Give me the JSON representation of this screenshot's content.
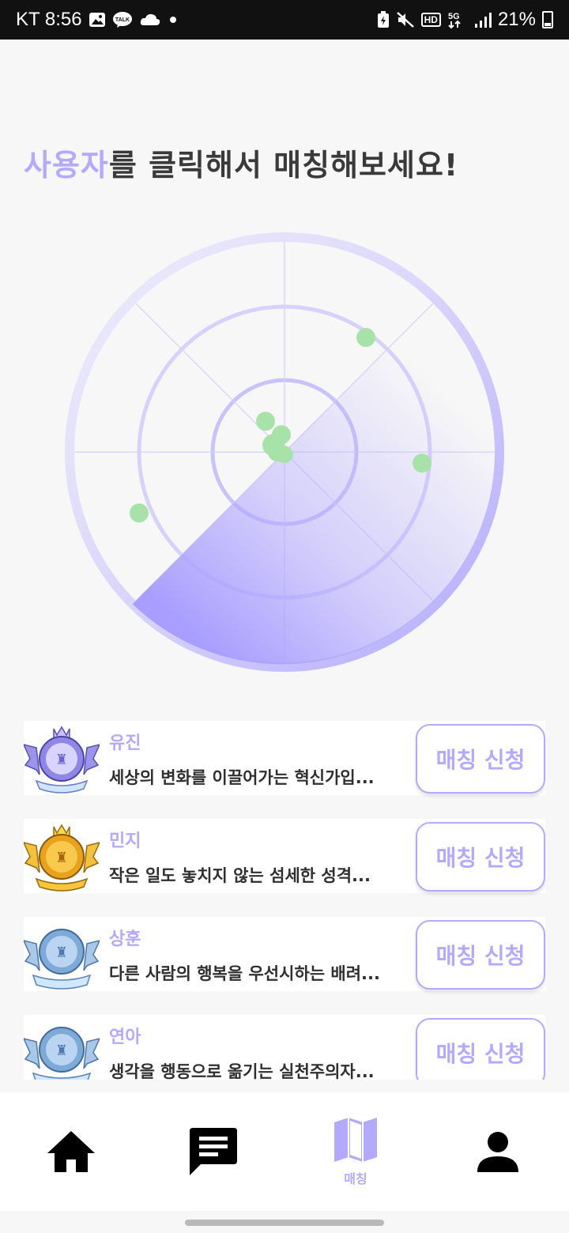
{
  "status_bar": {
    "carrier_time": "KT 8:56",
    "battery_percent": "21%",
    "icons": [
      "image-icon",
      "kakaotalk-icon",
      "cloud-icon",
      "dot-icon",
      "battery-saver-icon",
      "mute-icon",
      "hd-icon",
      "5g-icon",
      "signal-icon",
      "battery-icon"
    ],
    "hd_label": "HD",
    "net_label": "5G"
  },
  "headline": {
    "accent": "사용자",
    "rest": "를 클릭해서 매칭해보세요!"
  },
  "radar": {
    "accent_color": "#b3a9ff",
    "dot_color": "#a7e3a9",
    "users_visible": 8
  },
  "users": [
    {
      "name": "유진",
      "desc": "세상의 변화를 이끌어가는 혁신가입...",
      "button": "매칭 신청",
      "badge": "purple-wing-badge-icon"
    },
    {
      "name": "민지",
      "desc": "작은 일도 놓치지 않는 섬세한 성격...",
      "button": "매칭 신청",
      "badge": "gold-wing-badge-icon"
    },
    {
      "name": "상훈",
      "desc": "다른 사람의 행복을 우선시하는 배려...",
      "button": "매칭 신청",
      "badge": "blue-wing-badge-icon"
    },
    {
      "name": "연아",
      "desc": "생각을 행동으로 옮기는 실천주의자...",
      "button": "매칭 신청",
      "badge": "blue-wing-badge-icon"
    }
  ],
  "nav": {
    "home_icon": "home-icon",
    "chat_icon": "chat-icon",
    "map_icon": "map-icon",
    "map_label": "매칭",
    "profile_icon": "person-icon",
    "active_color": "#b3a9ff"
  }
}
